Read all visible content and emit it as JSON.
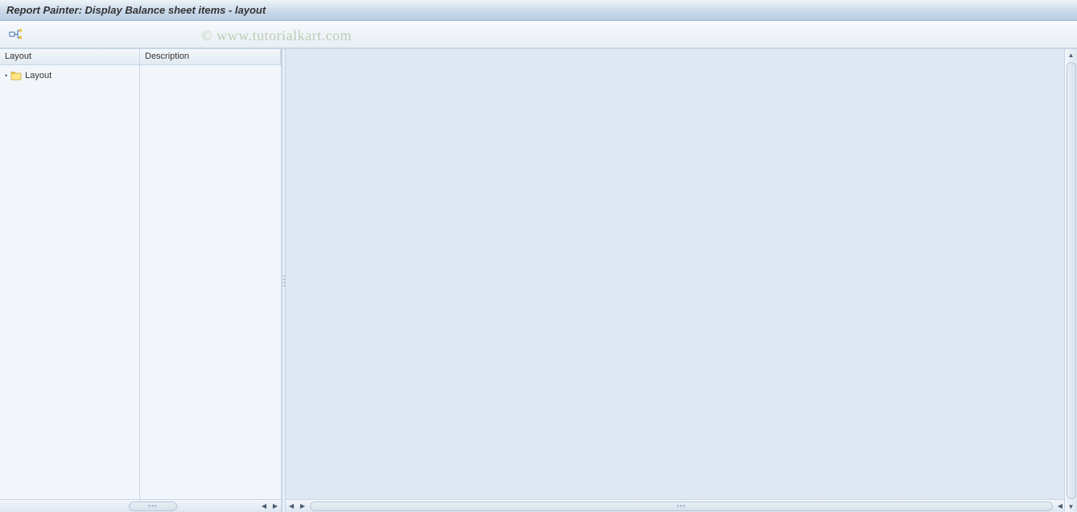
{
  "title": "Report Painter: Display Balance sheet items - layout",
  "watermark": "© www.tutorialkart.com",
  "toolbar": {
    "expand_icon": "expand-subtree"
  },
  "tree": {
    "headers": {
      "col1": "Layout",
      "col2": "Description"
    },
    "root": {
      "label": "Layout",
      "description": ""
    }
  }
}
